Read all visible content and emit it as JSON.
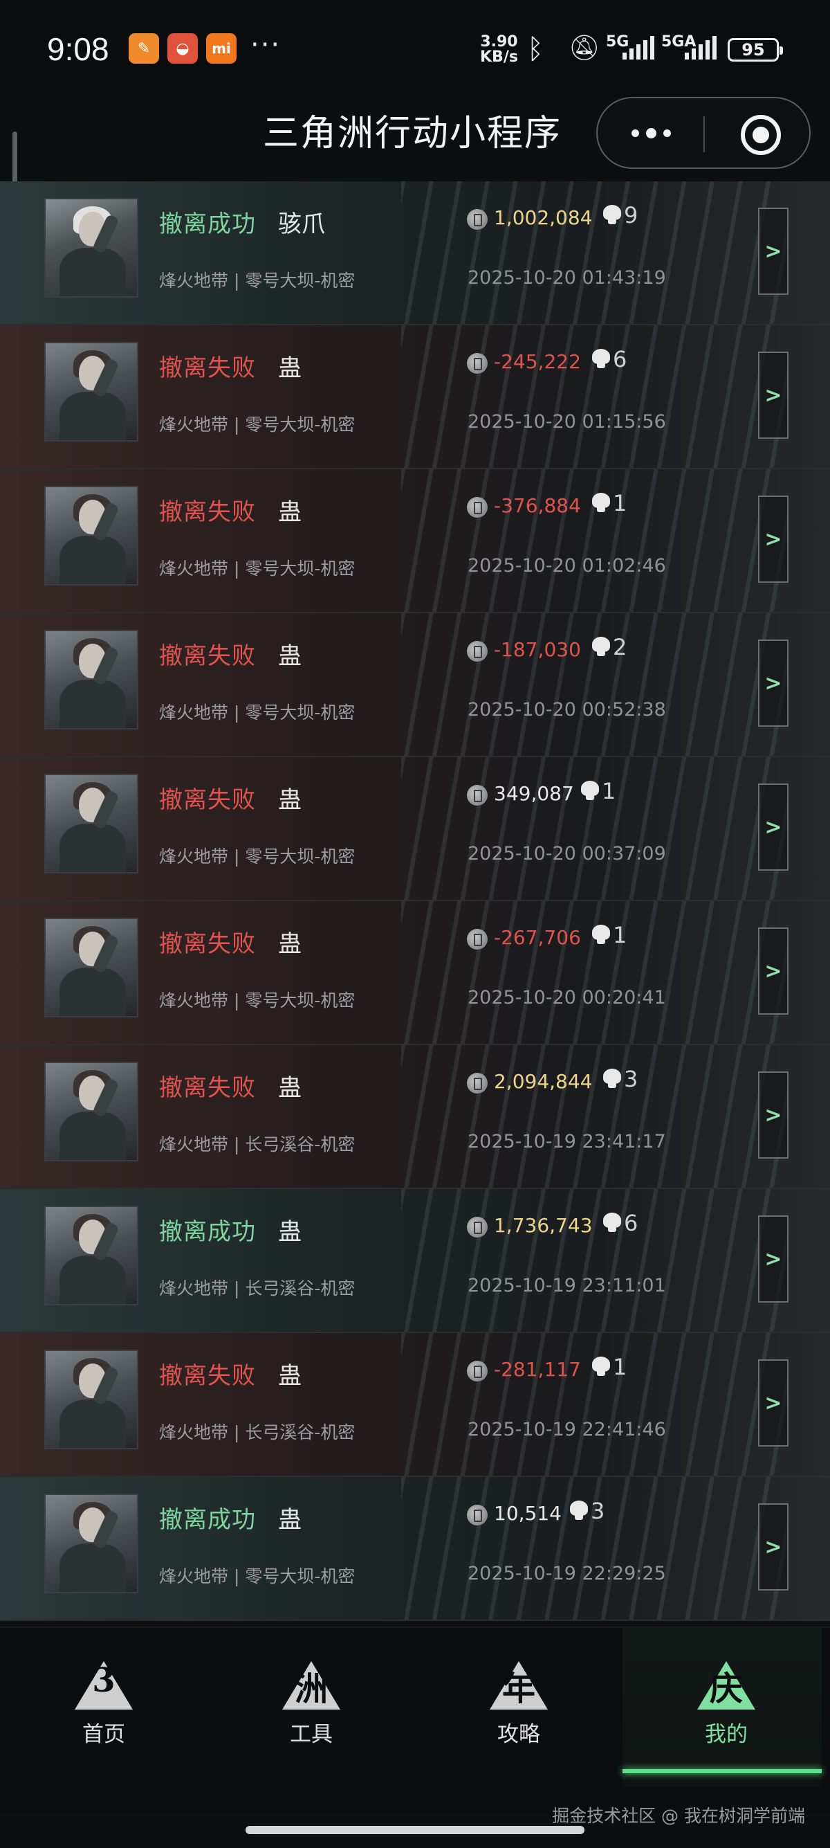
{
  "status_bar": {
    "time": "9:08",
    "apps": [
      {
        "icon": "app-icon-orange",
        "color": "#f08a2a",
        "glyph": "✎"
      },
      {
        "icon": "app-icon-red",
        "color": "#e0523a",
        "glyph": "◒"
      },
      {
        "icon": "mi-icon",
        "color": "#f2781e",
        "glyph": "mi"
      }
    ],
    "more": "···",
    "speed_top": "3.90",
    "speed_bottom": "KB/s",
    "net1": "5G",
    "net2": "5GA",
    "battery": "95"
  },
  "title_bar": {
    "title": "三角洲行动小程序"
  },
  "records": [
    {
      "result": "撤离成功",
      "status": "success",
      "player": "骇爪",
      "avatar": "female-1",
      "map": "烽火地带 | 零号大坝-机密",
      "value": "1,002,084",
      "value_tone": "gold",
      "kills": "9",
      "time": "2025-10-20 01:43:19"
    },
    {
      "result": "撤离失败",
      "status": "fail",
      "player": "蛊",
      "avatar": "female-2",
      "map": "烽火地带 | 零号大坝-机密",
      "value": "-245,222",
      "value_tone": "neg",
      "kills": "6",
      "time": "2025-10-20 01:15:56"
    },
    {
      "result": "撤离失败",
      "status": "fail",
      "player": "蛊",
      "avatar": "female-2",
      "map": "烽火地带 | 零号大坝-机密",
      "value": "-376,884",
      "value_tone": "neg",
      "kills": "1",
      "time": "2025-10-20 01:02:46"
    },
    {
      "result": "撤离失败",
      "status": "fail",
      "player": "蛊",
      "avatar": "female-2",
      "map": "烽火地带 | 零号大坝-机密",
      "value": "-187,030",
      "value_tone": "neg",
      "kills": "2",
      "time": "2025-10-20 00:52:38"
    },
    {
      "result": "撤离失败",
      "status": "fail",
      "player": "蛊",
      "avatar": "female-2",
      "map": "烽火地带 | 零号大坝-机密",
      "value": "349,087",
      "value_tone": "white",
      "kills": "1",
      "time": "2025-10-20 00:37:09"
    },
    {
      "result": "撤离失败",
      "status": "fail",
      "player": "蛊",
      "avatar": "female-2",
      "map": "烽火地带 | 零号大坝-机密",
      "value": "-267,706",
      "value_tone": "neg",
      "kills": "1",
      "time": "2025-10-20 00:20:41"
    },
    {
      "result": "撤离失败",
      "status": "fail",
      "player": "蛊",
      "avatar": "female-2",
      "map": "烽火地带 | 长弓溪谷-机密",
      "value": "2,094,844",
      "value_tone": "gold",
      "kills": "3",
      "time": "2025-10-19 23:41:17"
    },
    {
      "result": "撤离成功",
      "status": "success",
      "player": "蛊",
      "avatar": "female-2",
      "map": "烽火地带 | 长弓溪谷-机密",
      "value": "1,736,743",
      "value_tone": "gold",
      "kills": "6",
      "time": "2025-10-19 23:11:01"
    },
    {
      "result": "撤离失败",
      "status": "fail",
      "player": "蛊",
      "avatar": "female-2",
      "map": "烽火地带 | 长弓溪谷-机密",
      "value": "-281,117",
      "value_tone": "neg",
      "kills": "1",
      "time": "2025-10-19 22:41:46"
    },
    {
      "result": "撤离成功",
      "status": "success",
      "player": "蛊",
      "avatar": "female-2",
      "map": "烽火地带 | 零号大坝-机密",
      "value": "10,514",
      "value_tone": "white",
      "kills": "3",
      "time": "2025-10-19 22:29:25"
    }
  ],
  "detail_button_label": ">",
  "tabs": [
    {
      "label": "首页",
      "glyph": "3",
      "active": false
    },
    {
      "label": "工具",
      "glyph": "洲",
      "active": false
    },
    {
      "label": "攻略",
      "glyph": "年",
      "active": false
    },
    {
      "label": "我的",
      "glyph": "庆",
      "active": true
    }
  ],
  "accent_color": "#5de08a",
  "watermark": "掘金技术社区 @ 我在树洞学前端"
}
